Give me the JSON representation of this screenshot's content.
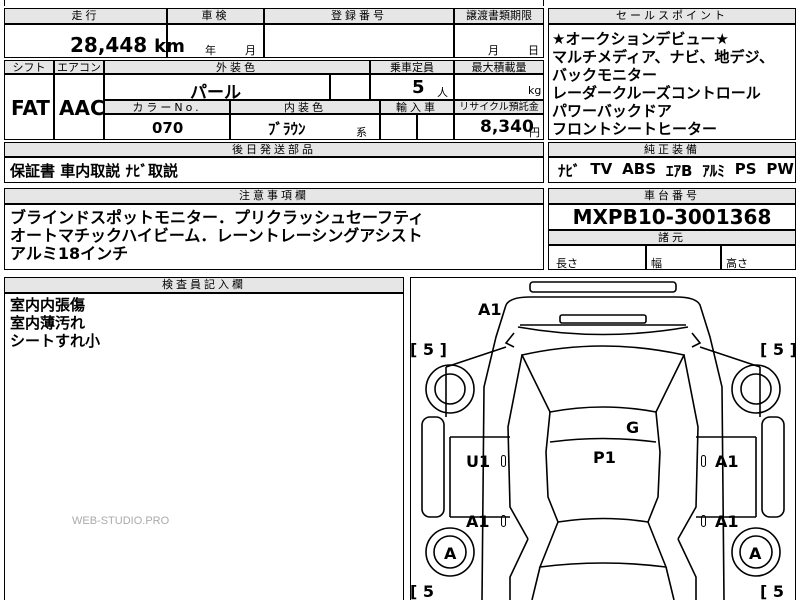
{
  "sheet": {
    "mileage_header": "走行",
    "mileage_value": "28,448",
    "mileage_unit": "km",
    "inspection_header": "車検",
    "inspection_year": "年",
    "inspection_month": "月",
    "registration_header": "登録番号",
    "transfer_header": "譲渡書類期限",
    "transfer_month": "月",
    "transfer_day": "日",
    "shift_header": "シフト",
    "shift_value": "FAT",
    "aircon_header": "エアコン",
    "aircon_value": "AAC",
    "exterior_color_header": "外装色",
    "exterior_color_value": "パール",
    "capacity_header": "乗車定員",
    "capacity_value": "5",
    "capacity_unit": "人",
    "max_load_header": "最大積載量",
    "max_load_unit": "kg",
    "color_no_header": "カラーNo.",
    "color_no_value": "070",
    "interior_color_header": "内装色",
    "interior_color_value": "ﾌﾞﾗｳﾝ",
    "interior_color_suffix": "系",
    "import_header": "輸入車",
    "recycle_header": "リサイクル預託金",
    "recycle_value": "8,340",
    "recycle_unit": "円",
    "later_parts_header": "後日発送部品",
    "later_parts_value": "保証書 車内取説 ﾅﾋﾞ取説",
    "sales_points_header": "セールスポイント",
    "sales_points": [
      "★オークションデビュー★",
      "マルチメディア、ナビ、地デジ、",
      "バックモニター",
      "レーダークルーズコントロール",
      "パワーバックドア",
      "フロントシートヒーター"
    ],
    "equipment_header": "純正装備",
    "equipment": [
      "ﾅﾋﾞ",
      "TV",
      "ABS",
      "ｴｱB",
      "ｱﾙﾐ",
      "PS",
      "PW"
    ],
    "notes_header": "注意事項欄",
    "notes": [
      "ブラインドスポットモニター．プリクラッシュセーフティ",
      "オートマチックハイビーム．レーントレーシングアシスト",
      "アルミ18インチ"
    ],
    "chassis_header": "車台番号",
    "chassis_value": "MXPB10-3001368",
    "dimensions_header": "諸元",
    "length_label": "長さ",
    "width_label": "幅",
    "height_label": "高さ",
    "inspector_header": "検査員記入欄",
    "inspector_notes": [
      "室内内張傷",
      "室内薄汚れ",
      "シートすれ小"
    ],
    "watermark": "WEB-STUDIO.PRO"
  },
  "diagram": {
    "marks": {
      "a1_top": "A1",
      "g": "G",
      "p1": "P1",
      "u1_left": "U1",
      "a1_right_front": "A1",
      "a1_left_rear": "A1",
      "a1_right_rear": "A1",
      "a_left": "A",
      "a_right": "A"
    },
    "tread": {
      "front_left": "[ 5 ]",
      "front_right": "[ 5 ]",
      "rear_left": "[ 5",
      "rear_right": "[ 5"
    }
  }
}
